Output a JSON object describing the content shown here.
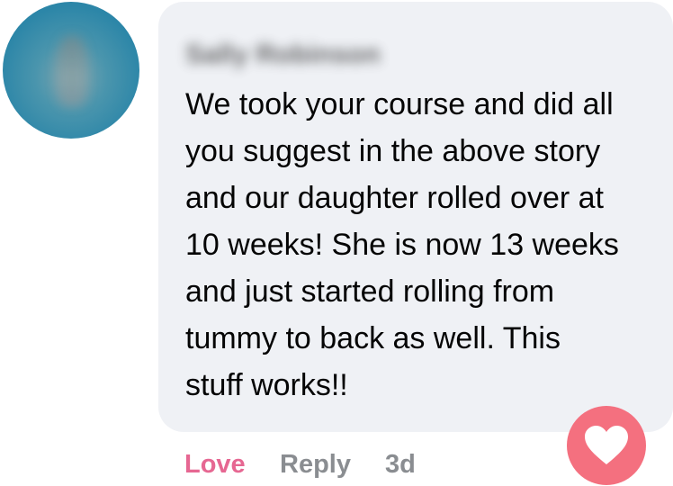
{
  "comment": {
    "author_name": "Sally Robinson",
    "lines": [
      "We took your course and did all",
      "you suggest in the above story",
      "and our daughter rolled over at",
      "10 weeks! She is now 13 weeks",
      "and just started rolling from",
      "tummy to back as well. This",
      "stuff works!!"
    ]
  },
  "actions": {
    "love_label": "Love",
    "reply_label": "Reply",
    "timestamp": "3d"
  },
  "reaction": {
    "icon": "heart-icon",
    "color": "#f4707f"
  },
  "colors": {
    "bubble_bg": "#eff1f5",
    "love": "#e66792",
    "muted": "#8a8d91"
  }
}
